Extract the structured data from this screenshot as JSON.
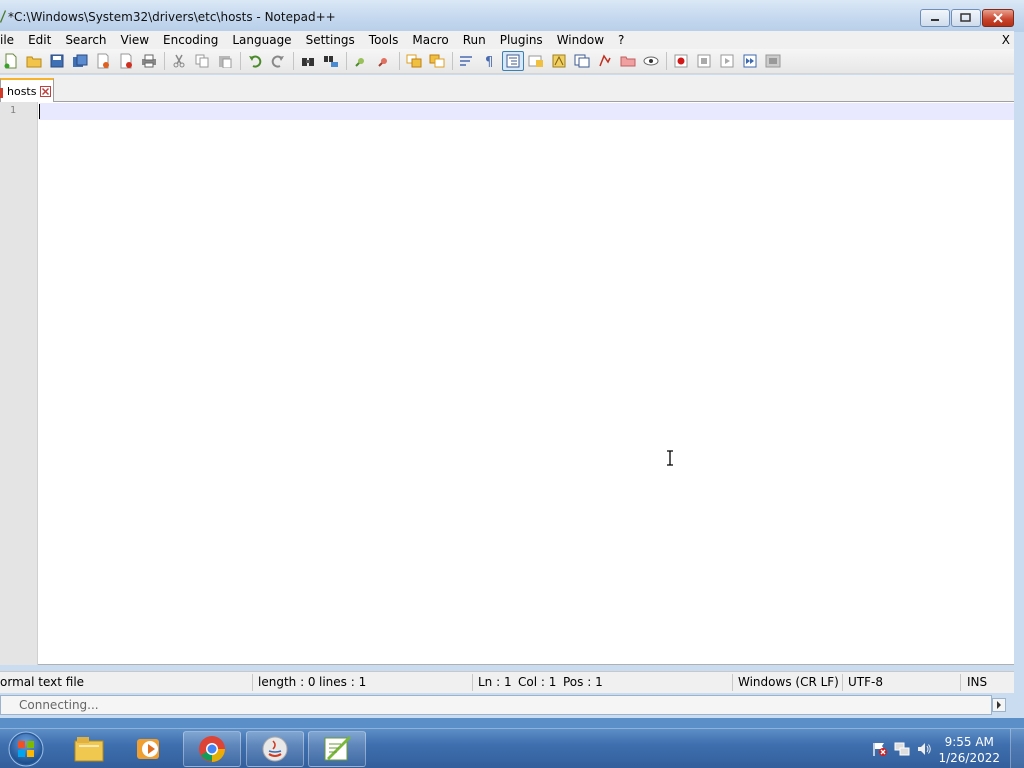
{
  "window": {
    "title": "*C:\\Windows\\System32\\drivers\\etc\\hosts - Notepad++"
  },
  "menubar": {
    "items": [
      "ile",
      "Edit",
      "Search",
      "View",
      "Encoding",
      "Language",
      "Settings",
      "Tools",
      "Macro",
      "Run",
      "Plugins",
      "Window",
      "?"
    ],
    "close_label": "X"
  },
  "toolbar": {
    "icons": [
      "new-file-icon",
      "open-file-icon",
      "save-icon",
      "save-all-icon",
      "close-icon",
      "close-all-icon",
      "print-icon",
      "cut-icon",
      "copy-icon",
      "paste-icon",
      "undo-icon",
      "redo-icon",
      "find-icon",
      "replace-icon",
      "zoom-in-icon",
      "zoom-out-icon",
      "sync-vertical-icon",
      "sync-horizontal-icon",
      "word-wrap-icon",
      "show-all-chars-icon",
      "indent-guide-icon",
      "doc-map-icon",
      "function-list-icon",
      "folder-workspace-icon",
      "monitoring-icon",
      "folder-icon",
      "eye-icon",
      "record-macro-icon",
      "stop-record-icon",
      "play-macro-icon",
      "run-macro-multiple-icon",
      "save-macro-icon"
    ]
  },
  "tab": {
    "label": "hosts"
  },
  "editor": {
    "line_number": "1",
    "content": ""
  },
  "statusbar": {
    "file_type": "ormal text file",
    "length": "length : 0",
    "lines": "lines : 1",
    "ln": "Ln : 1",
    "col": "Col : 1",
    "pos": "Pos : 1",
    "eol": "Windows (CR LF)",
    "encoding": "UTF-8",
    "mode": "INS"
  },
  "connbar": {
    "text": "Connecting..."
  },
  "taskbar": {
    "apps": [
      "explorer-icon",
      "media-player-icon",
      "chrome-icon",
      "java-icon",
      "notepadpp-icon"
    ],
    "time": "9:55 AM",
    "date": "1/26/2022"
  },
  "colors": {
    "titlebar": "#c3d7ee",
    "current_line": "#e8e8ff",
    "tab_accent": "#f7b32b",
    "taskbar": "#3f6fae"
  }
}
